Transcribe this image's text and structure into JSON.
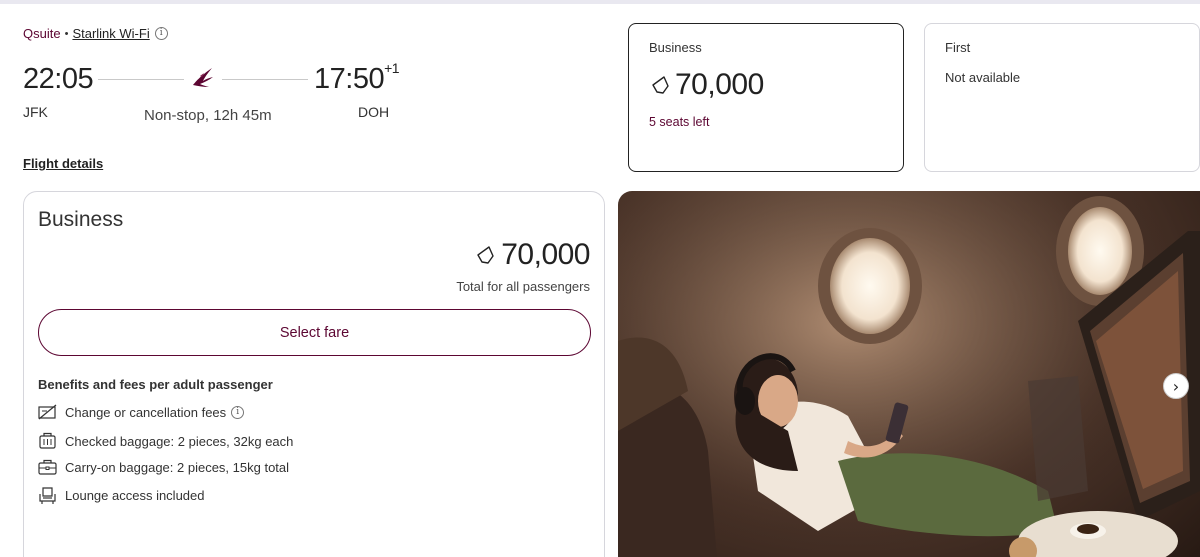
{
  "flight": {
    "product": "Qsuite",
    "wifi": "Starlink Wi-Fi",
    "departure_time": "22:05",
    "arrival_time": "17:50",
    "arrival_day_offset": "+1",
    "origin": "JFK",
    "destination": "DOH",
    "duration": "Non-stop, 12h 45m",
    "details_link": "Flight details"
  },
  "cabins": [
    {
      "name": "Business",
      "price": "70,000",
      "seats": "5 seats left",
      "selected": true
    },
    {
      "name": "First",
      "status": "Not available",
      "selected": false
    }
  ],
  "fare": {
    "title": "Business",
    "price": "70,000",
    "price_note": "Total for all passengers",
    "select_label": "Select fare",
    "benefits_title": "Benefits and fees per adult passenger",
    "benefits": [
      {
        "icon": "no-fee-icon",
        "label": "Change or cancellation fees"
      },
      {
        "icon": "checked-baggage-icon",
        "label": "Checked baggage: 2 pieces, 32kg each"
      },
      {
        "icon": "carry-on-icon",
        "label": "Carry-on baggage: 2 pieces, 15kg total"
      },
      {
        "icon": "lounge-seat-icon",
        "label": "Lounge access included"
      }
    ]
  },
  "colors": {
    "brand": "#5c0632",
    "border": "#d6d6dc"
  }
}
